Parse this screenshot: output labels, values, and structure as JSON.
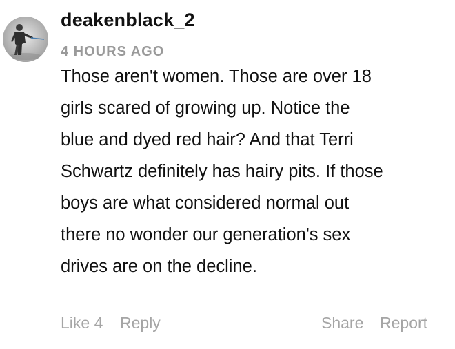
{
  "comment": {
    "username": "deakenblack_2",
    "timestamp": "4 HOURS AGO",
    "body_lines": [
      "Those aren't women. Those are over 18",
      "girls scared of growing up. Notice the",
      "blue and dyed red hair? And that Terri",
      "Schwartz definitely has hairy pits. If those",
      "boys are what considered normal out",
      "there no wonder our generation's sex",
      "drives are on the decline."
    ],
    "actions": {
      "like_label": "Like",
      "like_count": "4",
      "reply_label": "Reply",
      "share_label": "Share",
      "report_label": "Report"
    },
    "avatar_icon": "user-avatar-figure",
    "colors": {
      "text": "#111111",
      "muted": "#9a9a9a",
      "action": "#a5a5a5",
      "background": "#ffffff"
    }
  }
}
